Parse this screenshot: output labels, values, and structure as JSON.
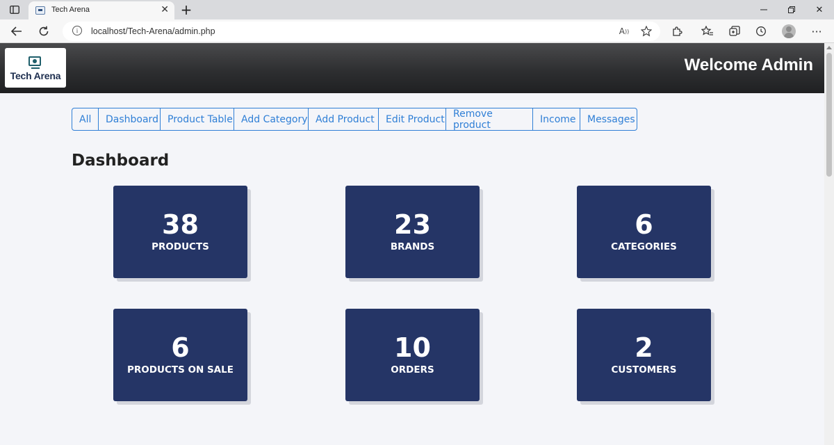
{
  "browser": {
    "tab_title": "Tech Arena",
    "url": "localhost/Tech-Arena/admin.php"
  },
  "header": {
    "logo_text": "Tech Arena",
    "welcome": "Welcome Admin"
  },
  "nav": {
    "items": [
      "All",
      "Dashboard",
      "Product Table",
      "Add Category",
      "Add Product",
      "Edit Product",
      "Remove product",
      "Income",
      "Messages"
    ]
  },
  "main": {
    "title": "Dashboard",
    "cards": [
      {
        "value": "38",
        "label": "PRODUCTS"
      },
      {
        "value": "23",
        "label": "BRANDS"
      },
      {
        "value": "6",
        "label": "CATEGORIES"
      },
      {
        "value": "6",
        "label": "PRODUCTS ON SALE"
      },
      {
        "value": "10",
        "label": "ORDERS"
      },
      {
        "value": "2",
        "label": "CUSTOMERS"
      }
    ]
  },
  "colors": {
    "card_bg": "#253566",
    "nav_accent": "#2f7fd6",
    "page_bg": "#f4f5f9"
  }
}
